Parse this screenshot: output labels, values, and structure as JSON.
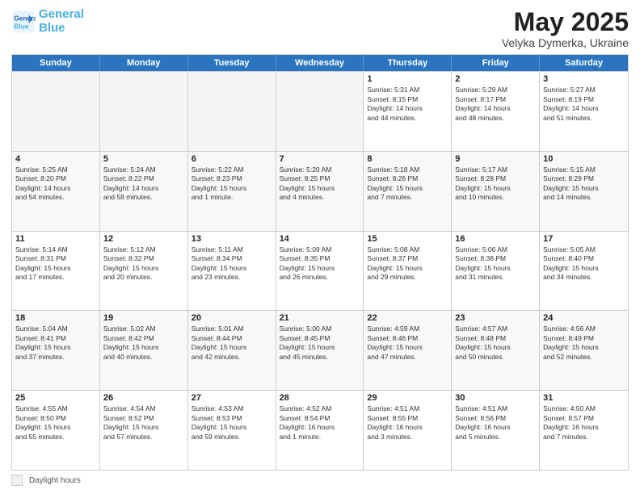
{
  "logo": {
    "text1": "General",
    "text2": "Blue"
  },
  "title": "May 2025",
  "location": "Velyka Dymerka, Ukraine",
  "days_of_week": [
    "Sunday",
    "Monday",
    "Tuesday",
    "Wednesday",
    "Thursday",
    "Friday",
    "Saturday"
  ],
  "legend": {
    "label": "Daylight hours"
  },
  "weeks": [
    [
      {
        "day": "",
        "text": "",
        "empty": true
      },
      {
        "day": "",
        "text": "",
        "empty": true
      },
      {
        "day": "",
        "text": "",
        "empty": true
      },
      {
        "day": "",
        "text": "",
        "empty": true
      },
      {
        "day": "1",
        "text": "Sunrise: 5:31 AM\nSunset: 8:15 PM\nDaylight: 14 hours\nand 44 minutes.",
        "empty": false
      },
      {
        "day": "2",
        "text": "Sunrise: 5:29 AM\nSunset: 8:17 PM\nDaylight: 14 hours\nand 48 minutes.",
        "empty": false
      },
      {
        "day": "3",
        "text": "Sunrise: 5:27 AM\nSunset: 8:19 PM\nDaylight: 14 hours\nand 51 minutes.",
        "empty": false
      }
    ],
    [
      {
        "day": "4",
        "text": "Sunrise: 5:25 AM\nSunset: 8:20 PM\nDaylight: 14 hours\nand 54 minutes.",
        "empty": false
      },
      {
        "day": "5",
        "text": "Sunrise: 5:24 AM\nSunset: 8:22 PM\nDaylight: 14 hours\nand 58 minutes.",
        "empty": false
      },
      {
        "day": "6",
        "text": "Sunrise: 5:22 AM\nSunset: 8:23 PM\nDaylight: 15 hours\nand 1 minute.",
        "empty": false
      },
      {
        "day": "7",
        "text": "Sunrise: 5:20 AM\nSunset: 8:25 PM\nDaylight: 15 hours\nand 4 minutes.",
        "empty": false
      },
      {
        "day": "8",
        "text": "Sunrise: 5:18 AM\nSunset: 8:26 PM\nDaylight: 15 hours\nand 7 minutes.",
        "empty": false
      },
      {
        "day": "9",
        "text": "Sunrise: 5:17 AM\nSunset: 8:28 PM\nDaylight: 15 hours\nand 10 minutes.",
        "empty": false
      },
      {
        "day": "10",
        "text": "Sunrise: 5:15 AM\nSunset: 8:29 PM\nDaylight: 15 hours\nand 14 minutes.",
        "empty": false
      }
    ],
    [
      {
        "day": "11",
        "text": "Sunrise: 5:14 AM\nSunset: 8:31 PM\nDaylight: 15 hours\nand 17 minutes.",
        "empty": false
      },
      {
        "day": "12",
        "text": "Sunrise: 5:12 AM\nSunset: 8:32 PM\nDaylight: 15 hours\nand 20 minutes.",
        "empty": false
      },
      {
        "day": "13",
        "text": "Sunrise: 5:11 AM\nSunset: 8:34 PM\nDaylight: 15 hours\nand 23 minutes.",
        "empty": false
      },
      {
        "day": "14",
        "text": "Sunrise: 5:09 AM\nSunset: 8:35 PM\nDaylight: 15 hours\nand 26 minutes.",
        "empty": false
      },
      {
        "day": "15",
        "text": "Sunrise: 5:08 AM\nSunset: 8:37 PM\nDaylight: 15 hours\nand 29 minutes.",
        "empty": false
      },
      {
        "day": "16",
        "text": "Sunrise: 5:06 AM\nSunset: 8:38 PM\nDaylight: 15 hours\nand 31 minutes.",
        "empty": false
      },
      {
        "day": "17",
        "text": "Sunrise: 5:05 AM\nSunset: 8:40 PM\nDaylight: 15 hours\nand 34 minutes.",
        "empty": false
      }
    ],
    [
      {
        "day": "18",
        "text": "Sunrise: 5:04 AM\nSunset: 8:41 PM\nDaylight: 15 hours\nand 37 minutes.",
        "empty": false
      },
      {
        "day": "19",
        "text": "Sunrise: 5:02 AM\nSunset: 8:42 PM\nDaylight: 15 hours\nand 40 minutes.",
        "empty": false
      },
      {
        "day": "20",
        "text": "Sunrise: 5:01 AM\nSunset: 8:44 PM\nDaylight: 15 hours\nand 42 minutes.",
        "empty": false
      },
      {
        "day": "21",
        "text": "Sunrise: 5:00 AM\nSunset: 8:45 PM\nDaylight: 15 hours\nand 45 minutes.",
        "empty": false
      },
      {
        "day": "22",
        "text": "Sunrise: 4:59 AM\nSunset: 8:46 PM\nDaylight: 15 hours\nand 47 minutes.",
        "empty": false
      },
      {
        "day": "23",
        "text": "Sunrise: 4:57 AM\nSunset: 8:48 PM\nDaylight: 15 hours\nand 50 minutes.",
        "empty": false
      },
      {
        "day": "24",
        "text": "Sunrise: 4:56 AM\nSunset: 8:49 PM\nDaylight: 15 hours\nand 52 minutes.",
        "empty": false
      }
    ],
    [
      {
        "day": "25",
        "text": "Sunrise: 4:55 AM\nSunset: 8:50 PM\nDaylight: 15 hours\nand 55 minutes.",
        "empty": false
      },
      {
        "day": "26",
        "text": "Sunrise: 4:54 AM\nSunset: 8:52 PM\nDaylight: 15 hours\nand 57 minutes.",
        "empty": false
      },
      {
        "day": "27",
        "text": "Sunrise: 4:53 AM\nSunset: 8:53 PM\nDaylight: 15 hours\nand 59 minutes.",
        "empty": false
      },
      {
        "day": "28",
        "text": "Sunrise: 4:52 AM\nSunset: 8:54 PM\nDaylight: 16 hours\nand 1 minute.",
        "empty": false
      },
      {
        "day": "29",
        "text": "Sunrise: 4:51 AM\nSunset: 8:55 PM\nDaylight: 16 hours\nand 3 minutes.",
        "empty": false
      },
      {
        "day": "30",
        "text": "Sunrise: 4:51 AM\nSunset: 8:56 PM\nDaylight: 16 hours\nand 5 minutes.",
        "empty": false
      },
      {
        "day": "31",
        "text": "Sunrise: 4:50 AM\nSunset: 8:57 PM\nDaylight: 16 hours\nand 7 minutes.",
        "empty": false
      }
    ]
  ]
}
